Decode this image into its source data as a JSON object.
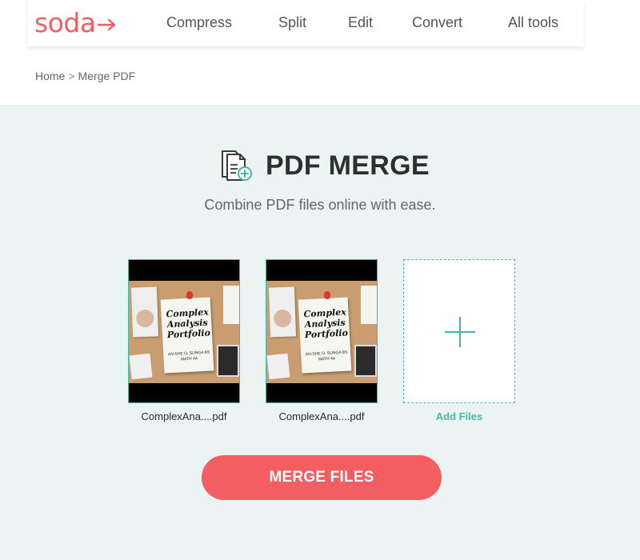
{
  "brand": {
    "logo_text": "soda",
    "accent": "#f25e62",
    "teal": "#45b8a5"
  },
  "nav": {
    "items": [
      "Compress",
      "Split",
      "Edit",
      "Convert",
      "All tools"
    ]
  },
  "breadcrumb": {
    "home": "Home",
    "separator": ">",
    "current": "Merge PDF"
  },
  "main": {
    "title": "PDF MERGE",
    "subtitle": "Combine PDF files online with ease.",
    "files": [
      {
        "name": "ComplexAna....pdf",
        "thumb_title": "Complex Analysis Portfolio",
        "thumb_sub": "AN-SHE O. SUNGA BS MATH 4A"
      },
      {
        "name": "ComplexAna....pdf",
        "thumb_title": "Complex Analysis Portfolio",
        "thumb_sub": "AN-SHE O. SUNGA BS MATH 4A"
      }
    ],
    "add_files_label": "Add Files",
    "merge_button": "MERGE FILES"
  },
  "icons": {
    "title_icon": "document-merge-icon",
    "add_icon": "plus-icon",
    "logo_arrow": "arrow-right-icon"
  }
}
